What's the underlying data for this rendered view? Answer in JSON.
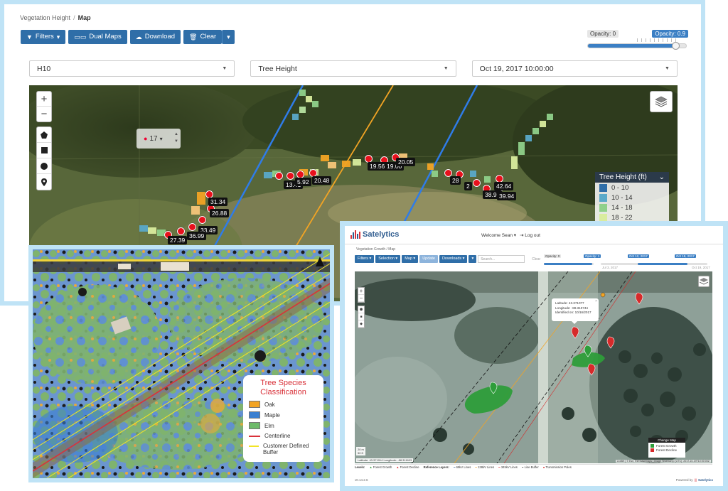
{
  "main": {
    "breadcrumb": [
      "Vegetation Height",
      "Map"
    ],
    "toolbar": {
      "filters": "Filters",
      "dual_maps": "Dual Maps",
      "download": "Download",
      "clear": "Clear"
    },
    "opacity": {
      "min_label": "Opacity: 0",
      "max_label": "Opacity: 0.9",
      "value": 0.9
    },
    "selects": {
      "asset": "H10",
      "layer": "Tree Height",
      "date": "Oct 19, 2017 10:00:00"
    },
    "level_control": "17",
    "height_tags": [
      "31.34",
      "26.88",
      "33.49",
      "36.99",
      "27.39",
      "13.41",
      "5.92",
      "20.48",
      "19.56",
      "19.00",
      "20.05",
      "28",
      "2",
      "38.91",
      "42.64",
      "39.94"
    ],
    "legend": {
      "title": "Tree Height (ft)",
      "items": [
        {
          "label": "0 - 10",
          "color": "#2f6ea8"
        },
        {
          "label": "10 - 14",
          "color": "#5aa9c9"
        },
        {
          "label": "14 - 18",
          "color": "#8fd08a"
        },
        {
          "label": "18 - 22",
          "color": "#d9ec9e"
        }
      ]
    }
  },
  "species": {
    "legend_title": "Tree Species Classification",
    "items": [
      {
        "label": "Oak",
        "color": "#f2a424",
        "kind": "swatch"
      },
      {
        "label": "Maple",
        "color": "#3a7fd0",
        "kind": "swatch"
      },
      {
        "label": "Elm",
        "color": "#6dbb6a",
        "kind": "swatch"
      },
      {
        "label": "Centerline",
        "color": "#d9323a",
        "kind": "line"
      },
      {
        "label": "Customer Defined Buffer",
        "color": "#f2e425",
        "kind": "line"
      }
    ]
  },
  "sat": {
    "brand": "Satelytics",
    "welcome": "Welcome Sean ▾",
    "logout": "Log out",
    "breadcrumb": "Vegetation Growth / Map",
    "tools": {
      "filters": "Filters ▾",
      "selection": "Selection ▾",
      "map": "Map ▾",
      "update": "Update",
      "downloads": "Downloads ▾",
      "search_placeholder": "Search...",
      "clear": "Clear"
    },
    "sliders": {
      "opacity_min": "Opacity: 0",
      "opacity_max": "Opacity: 1",
      "date_a": "Oct 12, 2017",
      "date_b": "Oct 19, 2017",
      "date_start": "Jul 3, 2017",
      "date_end": "Oct 19, 2017"
    },
    "popup": {
      "lat": "Latitude: 43.371077",
      "lon": "Longitude: -88.310744",
      "identified": "Identified on: 10/16/2017"
    },
    "change_legend": {
      "title": "Change Map",
      "growth": "Forest Growth",
      "decline": "Forest Decline",
      "growth_color": "#2e9d3a",
      "decline_color": "#d62a2a"
    },
    "scale": [
      "20 m",
      "50 ft"
    ],
    "coords": "Latitude: 43.371914  Longitude: -88.311603",
    "attribution": "Leaflet | © Esri, Esri basemaps | Image Timestamp (UTC): 2017-10-19T10:00:00Z",
    "bottom_bar": [
      "Levels:",
      "Forest Growth",
      "Forest Decline",
      "Reference Layers:",
      "69kV Lines",
      "138kV Lines",
      "345kV Lines",
      "Line Buffer",
      "Transmission Poles"
    ],
    "version": "v0.14.2.6",
    "powered": "Powered by",
    "powered_brand": "Satelytics"
  }
}
